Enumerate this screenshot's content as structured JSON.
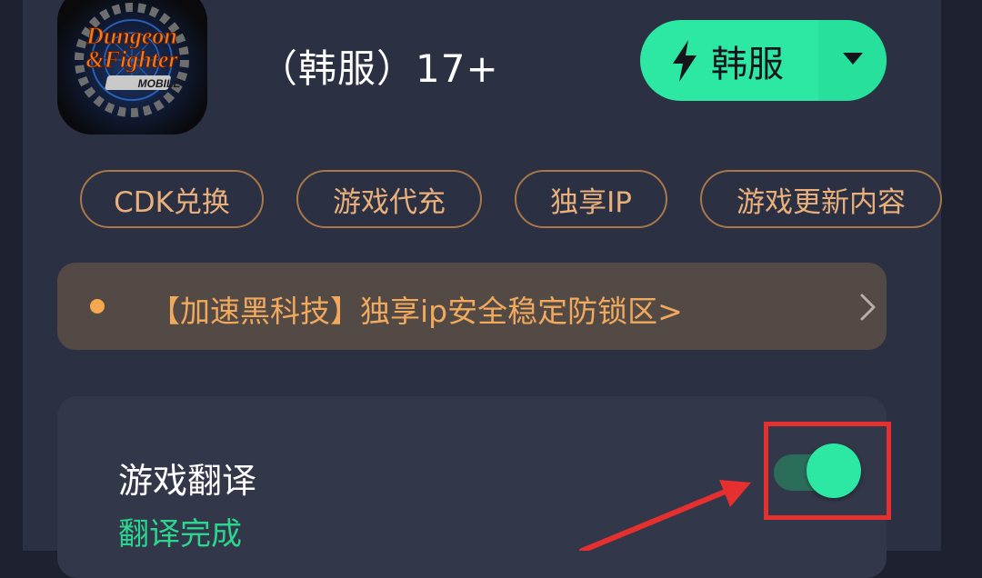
{
  "game": {
    "title": "（韩服）17+",
    "icon_name": "dungeon-fighter-mobile-logo"
  },
  "region_button": {
    "label": "韩服",
    "icon": "lightning-bolt-icon",
    "dropdown_icon": "caret-down-icon",
    "color": "#2de8a3"
  },
  "chips": [
    {
      "label": "CDK兑换"
    },
    {
      "label": "游戏代充"
    },
    {
      "label": "独享IP"
    },
    {
      "label": "游戏更新内容"
    }
  ],
  "notice": {
    "text": "【加速黑科技】独享ip安全稳定防锁区>",
    "icon": "chevron-right-icon",
    "dot_color": "#f5a84d"
  },
  "translation": {
    "title": "游戏翻译",
    "status": "翻译完成",
    "toggle_on": true,
    "status_color": "#2bd68f"
  },
  "annotation": {
    "color": "#e62f2f",
    "shapes": [
      "highlight-box",
      "pointer-arrow"
    ]
  }
}
